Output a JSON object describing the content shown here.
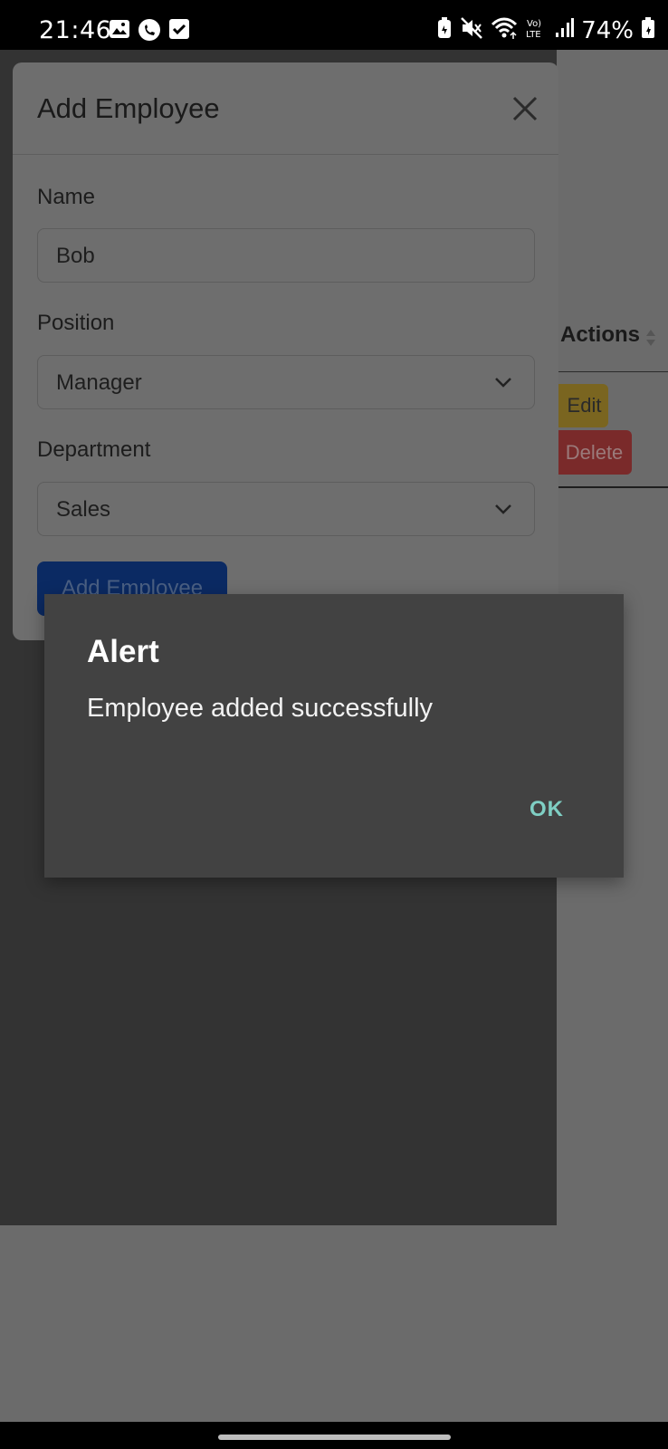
{
  "status_bar": {
    "time": "21:46",
    "battery": "74%",
    "left_icons": [
      "image-icon",
      "chat-icon",
      "check-box-icon"
    ],
    "right_icons": [
      "battery-saver-icon",
      "mute-icon",
      "wifi-icon",
      "volte-icon",
      "signal-icon",
      "battery-icon"
    ]
  },
  "background_table": {
    "actions_header": "Actions",
    "edit_label": "Edit",
    "delete_label": "Delete"
  },
  "modal": {
    "title": "Add Employee",
    "name_label": "Name",
    "name_value": "Bob",
    "position_label": "Position",
    "position_value": "Manager",
    "department_label": "Department",
    "department_value": "Sales",
    "submit_label": "Add Employee"
  },
  "alert": {
    "title": "Alert",
    "message": "Employee added successfully",
    "ok_label": "OK",
    "ok_color": "#7fcfc4"
  }
}
